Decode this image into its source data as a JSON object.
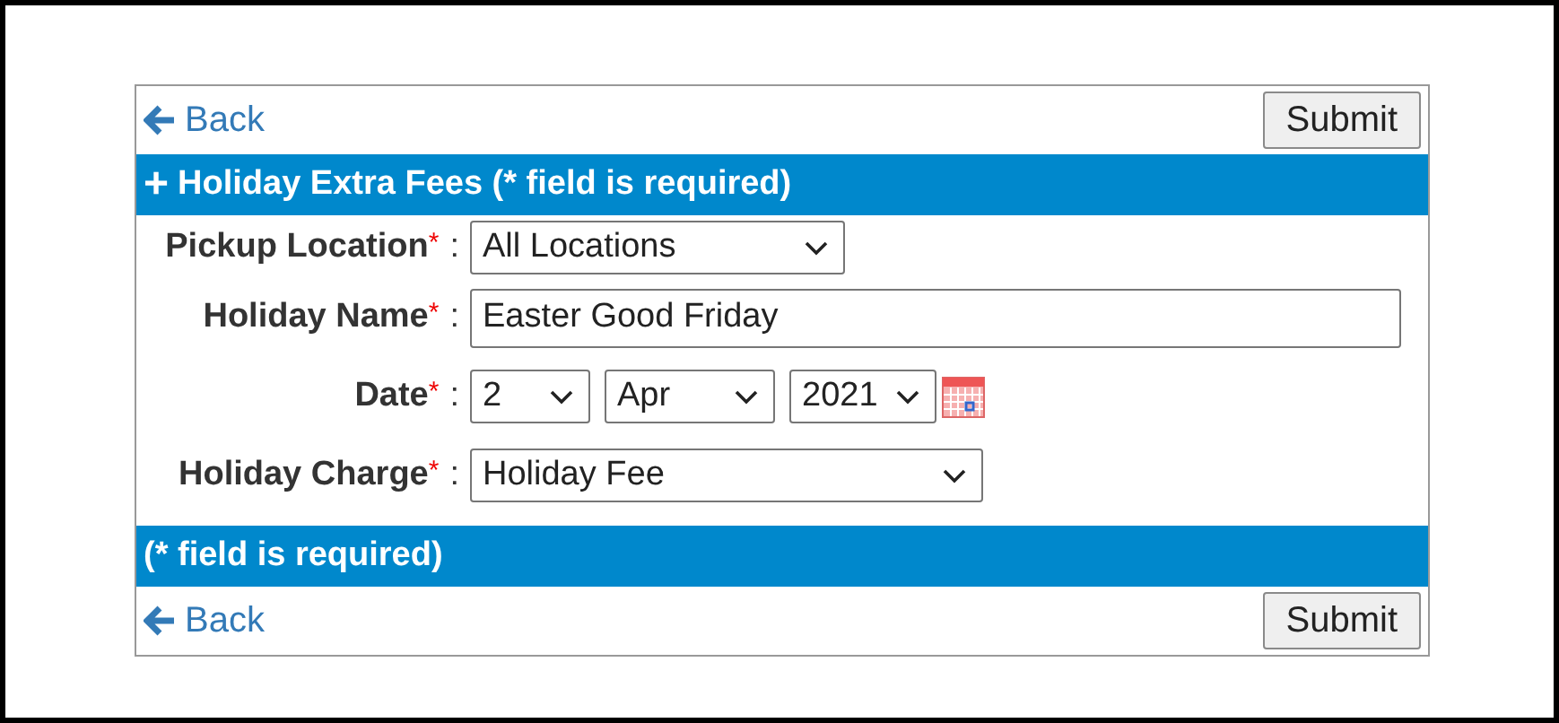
{
  "top_toolbar": {
    "back": "Back",
    "submit": "Submit"
  },
  "header": {
    "icon": "+",
    "title": "Holiday Extra Fees (* field is required)"
  },
  "fields": [
    {
      "kind": "select",
      "label": "Pickup Location",
      "required": "*",
      "colon": ":",
      "value": "All Locations"
    },
    {
      "kind": "text",
      "label": "Holiday Name",
      "required": "*",
      "colon": ":",
      "value": "Easter Good Friday"
    },
    {
      "kind": "date",
      "label": "Date",
      "required": "*",
      "colon": ":",
      "day": "2",
      "month": "Apr",
      "year": "2021"
    },
    {
      "kind": "select",
      "label": "Holiday Charge",
      "required": "*",
      "colon": ":",
      "value": "Holiday Fee"
    }
  ],
  "footer": {
    "title": "(* field is required)"
  },
  "bottom_toolbar": {
    "back": "Back",
    "submit": "Submit"
  }
}
